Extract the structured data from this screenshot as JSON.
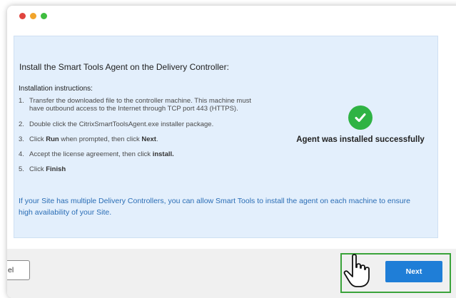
{
  "page": {
    "heading": "Install the Smart Tools Agent on the Delivery Controller:",
    "subheading": "Installation instructions:",
    "steps": [
      {
        "num": "1.",
        "text": "Transfer the downloaded file to the controller machine. This machine must have outbound access to the Internet through TCP port 443 (HTTPS)."
      },
      {
        "num": "2.",
        "text": "Double click the CitrixSmartToolsAgent.exe installer package."
      },
      {
        "num": "3.",
        "pre": "Click ",
        "bold1": "Run",
        "mid": " when prompted, then click ",
        "bold2": "Next",
        "post": "."
      },
      {
        "num": "4.",
        "pre": "Accept the license agreement, then click ",
        "bold1": "install."
      },
      {
        "num": "5.",
        "pre": "Click ",
        "bold1": "Finish"
      }
    ],
    "note": "If your Site has multiple Delivery Controllers, you can allow Smart Tools to install the agent on each machine to ensure high availability of your Site.",
    "status_text": "Agent was installed successfully",
    "status_icon": "check-circle-icon",
    "status_color": "#2fb344"
  },
  "footer": {
    "cancel_label": "el",
    "next_label": "Next",
    "next_color": "#1f7ed7",
    "highlight_color": "#3aa33a"
  },
  "cursor": {
    "icon": "hand-pointer-icon"
  }
}
